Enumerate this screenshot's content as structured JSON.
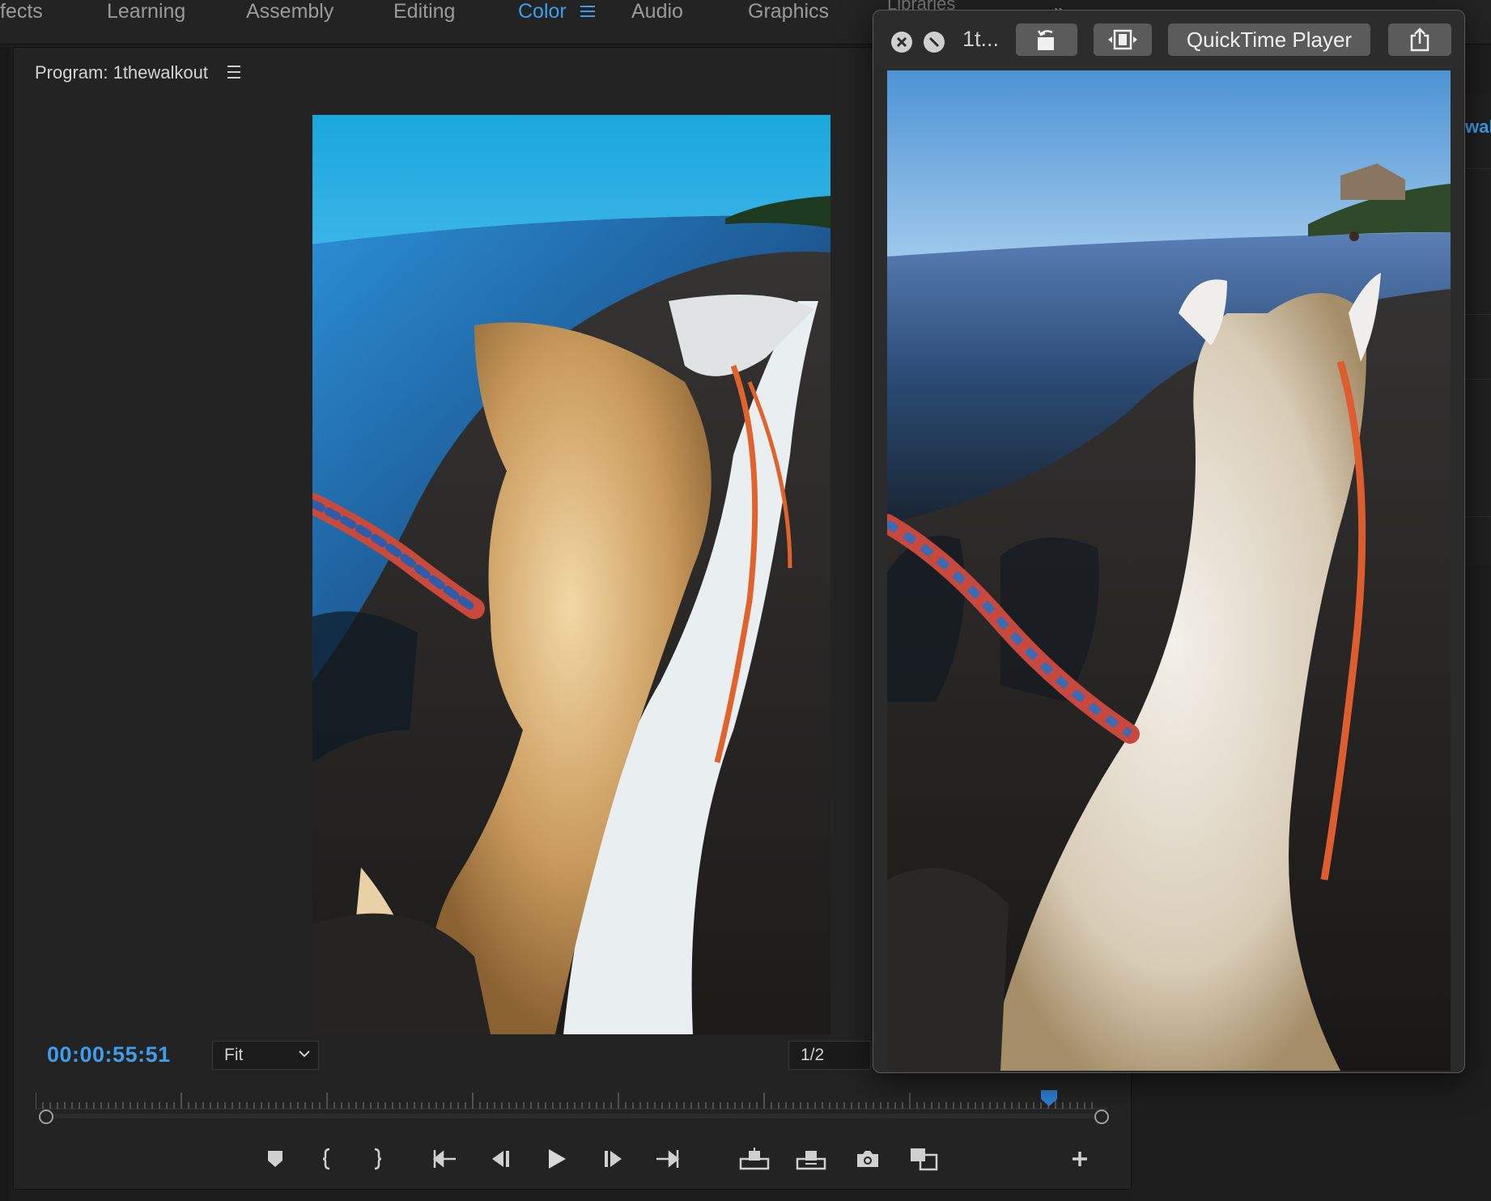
{
  "workspace": {
    "tabs": [
      {
        "label": "fects",
        "active": false
      },
      {
        "label": "Learning",
        "active": false
      },
      {
        "label": "Assembly",
        "active": false
      },
      {
        "label": "Editing",
        "active": false
      },
      {
        "label": "Color",
        "active": true
      },
      {
        "label": "Audio",
        "active": false
      },
      {
        "label": "Graphics",
        "active": false
      }
    ],
    "partial_tab": "Libraries",
    "accent_color": "#3f9ded"
  },
  "program_monitor": {
    "title": "Program: 1thewalkout",
    "timecode": "00:00:55:51",
    "zoom": "Fit",
    "resolution": "1/2",
    "playhead_fraction": 0.95,
    "transport_buttons": [
      {
        "name": "add-marker",
        "icon": "marker-icon"
      },
      {
        "name": "mark-in",
        "icon": "mark-in-icon"
      },
      {
        "name": "mark-out",
        "icon": "mark-out-icon"
      },
      {
        "name": "go-to-in",
        "icon": "go-to-in-icon"
      },
      {
        "name": "step-back",
        "icon": "step-back-icon"
      },
      {
        "name": "play",
        "icon": "play-icon"
      },
      {
        "name": "step-forward",
        "icon": "step-forward-icon"
      },
      {
        "name": "go-to-out",
        "icon": "go-to-out-icon"
      },
      {
        "name": "lift",
        "icon": "lift-icon"
      },
      {
        "name": "extract",
        "icon": "extract-icon"
      },
      {
        "name": "export-frame",
        "icon": "camera-icon"
      },
      {
        "name": "comparison-view",
        "icon": "comparison-view-icon"
      },
      {
        "name": "button-editor",
        "icon": "plus-icon"
      }
    ]
  },
  "right_panel": {
    "edge_label": "wal"
  },
  "quicktime": {
    "title": "1t...",
    "app_button": "QuickTime Player",
    "icons": [
      "close-icon",
      "minimize-icon",
      "rotate-icon",
      "trim-icon",
      "share-icon"
    ]
  }
}
